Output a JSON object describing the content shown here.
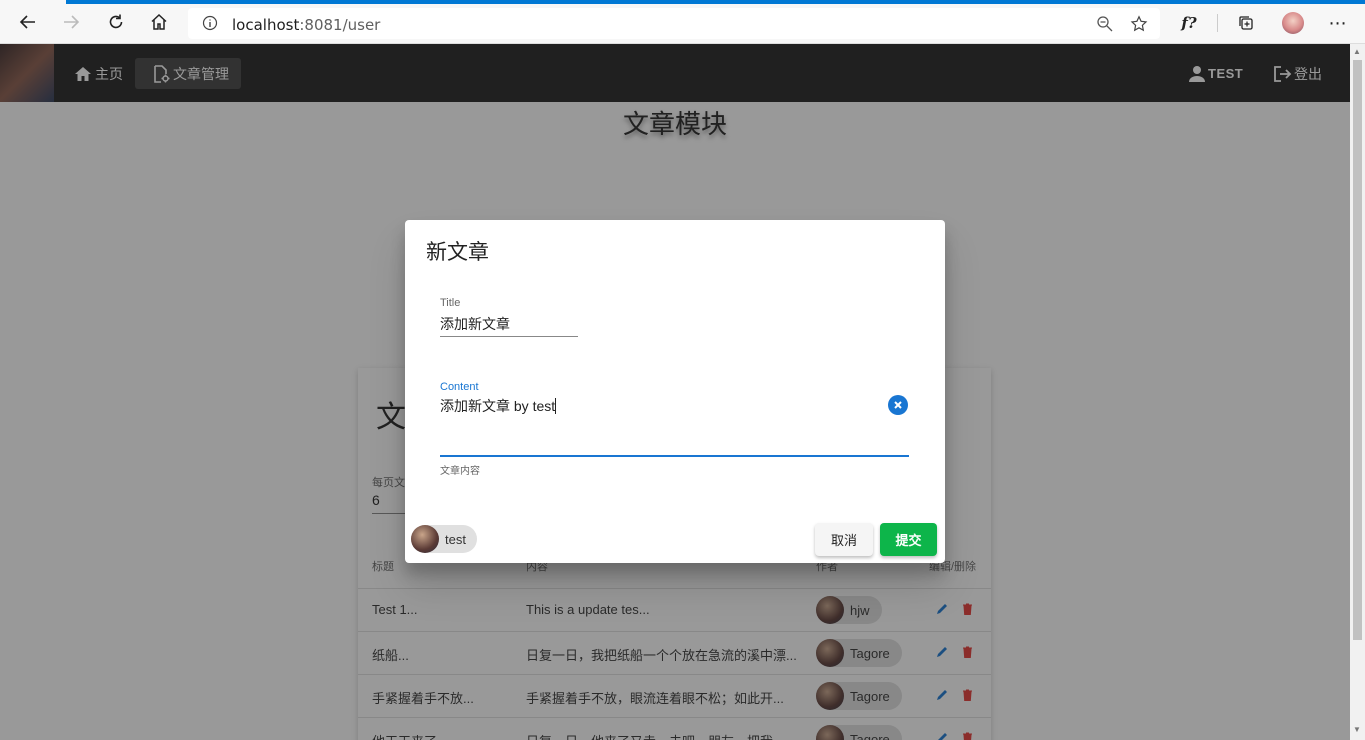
{
  "browser": {
    "url_host": "localhost",
    "url_rest": ":8081/user"
  },
  "nav": {
    "home_label": "主页",
    "articles_label": "文章管理",
    "user_label": "TEST",
    "logout_label": "登出"
  },
  "page": {
    "title": "文章模块",
    "card_title": "文",
    "per_page_label": "每页文",
    "per_page_value": "6",
    "table": {
      "headers": [
        "标题",
        "内容",
        "作者",
        "编辑/删除"
      ],
      "rows": [
        {
          "title": "Test 1...",
          "content": "This is a update tes...",
          "author": "hjw"
        },
        {
          "title": "纸船...",
          "content": "日复一日，我把纸船一个个放在急流的溪中漂...",
          "author": "Tagore"
        },
        {
          "title": "手紧握着手不放...",
          "content": "手紧握着手不放，眼流连着眼不松；如此开...",
          "author": "Tagore"
        },
        {
          "title": "他天天来了...",
          "content": "日复一日，他来了又走。去吧，朋友，把我...",
          "author": "Tagore"
        }
      ]
    }
  },
  "dialog": {
    "title": "新文章",
    "title_field": {
      "label": "Title",
      "value": "添加新文章"
    },
    "content_field": {
      "label": "Content",
      "value": "添加新文章  by test",
      "hint": "文章内容"
    },
    "author_chip": "test",
    "cancel_label": "取消",
    "submit_label": "提交"
  },
  "colors": {
    "app_bar": "#212121",
    "accent": "#1976d2",
    "submit": "#0db54a",
    "delete": "#e53935"
  }
}
